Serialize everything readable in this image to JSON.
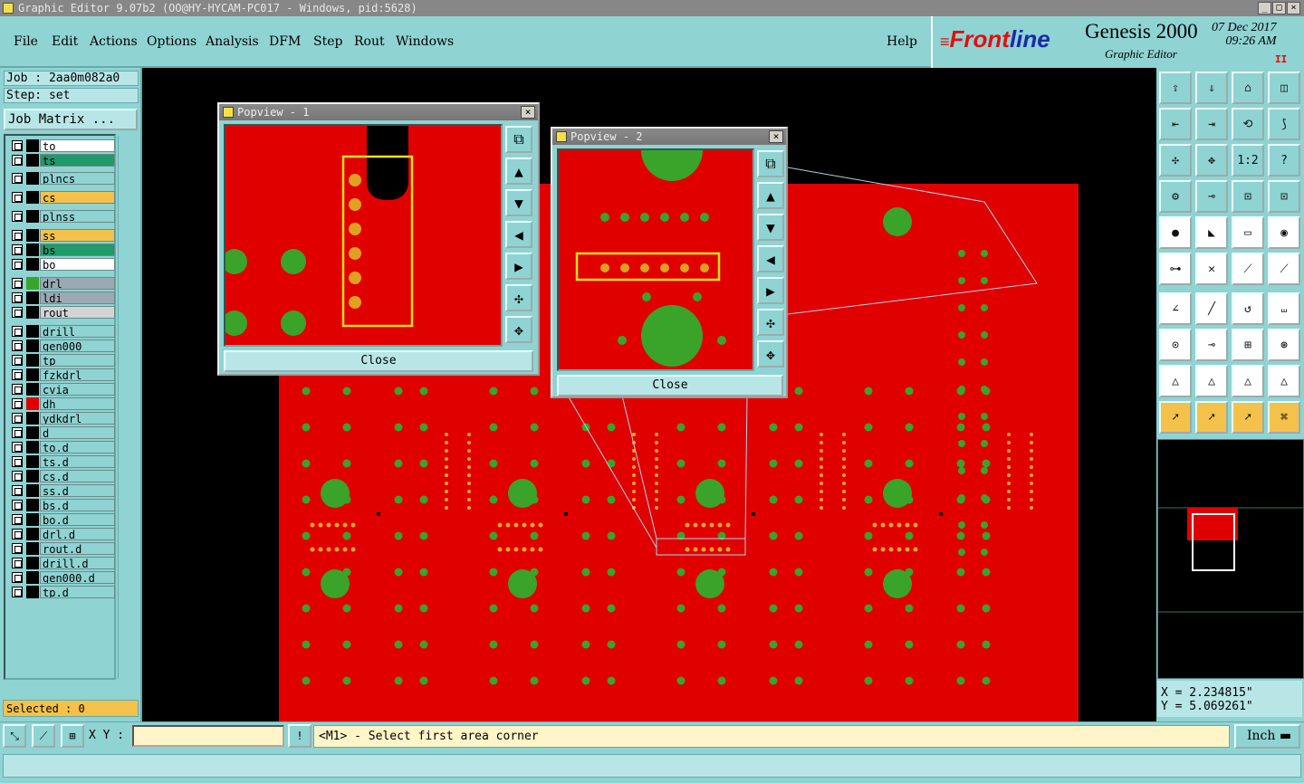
{
  "window": {
    "title": "Graphic Editor 9.07b2 (OO@HY-HYCAM-PC017 - Windows, pid:5628)"
  },
  "menu": {
    "file": "File",
    "edit": "Edit",
    "actions": "Actions",
    "options": "Options",
    "analysis": "Analysis",
    "dfm": "DFM",
    "step": "Step",
    "rout": "Rout",
    "windows": "Windows",
    "help": "Help"
  },
  "brand": {
    "logo_a": "Front",
    "logo_b": "line",
    "product": "Genesis 2000",
    "subtitle": "Graphic Editor",
    "date": "07 Dec 2017",
    "time": "09:26 AM",
    "pause": "II"
  },
  "job": {
    "job_label": "Job : 2aa0m082a0",
    "step_label": "Step: set",
    "matrix_button": "Job Matrix ..."
  },
  "layers": [
    {
      "name": "to",
      "color": "#ffffff",
      "swatch": "#000000"
    },
    {
      "name": "ts",
      "color": "#1f9a6a",
      "swatch": "#000000"
    },
    {
      "name": "plncs",
      "color": "#8fd3d3",
      "swatch": "#000000"
    },
    {
      "name": "cs",
      "color": "#f4c24a",
      "swatch": "#000000"
    },
    {
      "name": "plnss",
      "color": "#8fd3d3",
      "swatch": "#000000"
    },
    {
      "name": "ss",
      "color": "#f4c24a",
      "swatch": "#000000"
    },
    {
      "name": "bs",
      "color": "#1f9a6a",
      "swatch": "#000000"
    },
    {
      "name": "bo",
      "color": "#ffffff",
      "swatch": "#000000"
    },
    {
      "name": "drl",
      "color": "#9aa9b4",
      "swatch": "#3aa32a"
    },
    {
      "name": "ldi",
      "color": "#9aa9b4",
      "swatch": "#000000"
    },
    {
      "name": "rout",
      "color": "#d4d4d4",
      "swatch": "#000000"
    },
    {
      "name": "drill",
      "color": "#8fd3d3",
      "swatch": "#000000"
    },
    {
      "name": "gen000",
      "color": "#8fd3d3",
      "swatch": "#000000"
    },
    {
      "name": "tp",
      "color": "#8fd3d3",
      "swatch": "#000000"
    },
    {
      "name": "fzkdrl",
      "color": "#8fd3d3",
      "swatch": "#000000"
    },
    {
      "name": "cvia",
      "color": "#8fd3d3",
      "swatch": "#000000"
    },
    {
      "name": "dh",
      "color": "#8fd3d3",
      "swatch": "#e00000"
    },
    {
      "name": "ydkdrl",
      "color": "#8fd3d3",
      "swatch": "#000000"
    },
    {
      "name": "d",
      "color": "#8fd3d3",
      "swatch": "#000000"
    },
    {
      "name": "to.d",
      "color": "#8fd3d3",
      "swatch": "#000000"
    },
    {
      "name": "ts.d",
      "color": "#8fd3d3",
      "swatch": "#000000"
    },
    {
      "name": "cs.d",
      "color": "#8fd3d3",
      "swatch": "#000000"
    },
    {
      "name": "ss.d",
      "color": "#8fd3d3",
      "swatch": "#000000"
    },
    {
      "name": "bs.d",
      "color": "#8fd3d3",
      "swatch": "#000000"
    },
    {
      "name": "bo.d",
      "color": "#8fd3d3",
      "swatch": "#000000"
    },
    {
      "name": "drl.d",
      "color": "#8fd3d3",
      "swatch": "#000000"
    },
    {
      "name": "rout.d",
      "color": "#8fd3d3",
      "swatch": "#000000"
    },
    {
      "name": "drill.d",
      "color": "#8fd3d3",
      "swatch": "#000000"
    },
    {
      "name": "gen000.d",
      "color": "#8fd3d3",
      "swatch": "#000000"
    },
    {
      "name": "tp.d",
      "color": "#8fd3d3",
      "swatch": "#000000"
    }
  ],
  "status": {
    "selected": "Selected : 0",
    "xy_label": "X Y :",
    "xy_value": "",
    "prompt": "<M1> - Select first area corner",
    "unit": "Inch"
  },
  "coords": {
    "x": "X = 2.234815\"",
    "y": "Y = 5.069261\""
  },
  "popview1": {
    "title": "Popview - 1",
    "close": "Close"
  },
  "popview2": {
    "title": "Popview - 2",
    "close": "Close"
  },
  "toolbar": {
    "ratio_label": "1:2",
    "help_label": "?"
  },
  "colors": {
    "copper": "#e00000",
    "pad": "#3aa32a",
    "small_pad": "#f4a623",
    "highlight": "#f0e020",
    "panel": "#8fd3d3"
  }
}
